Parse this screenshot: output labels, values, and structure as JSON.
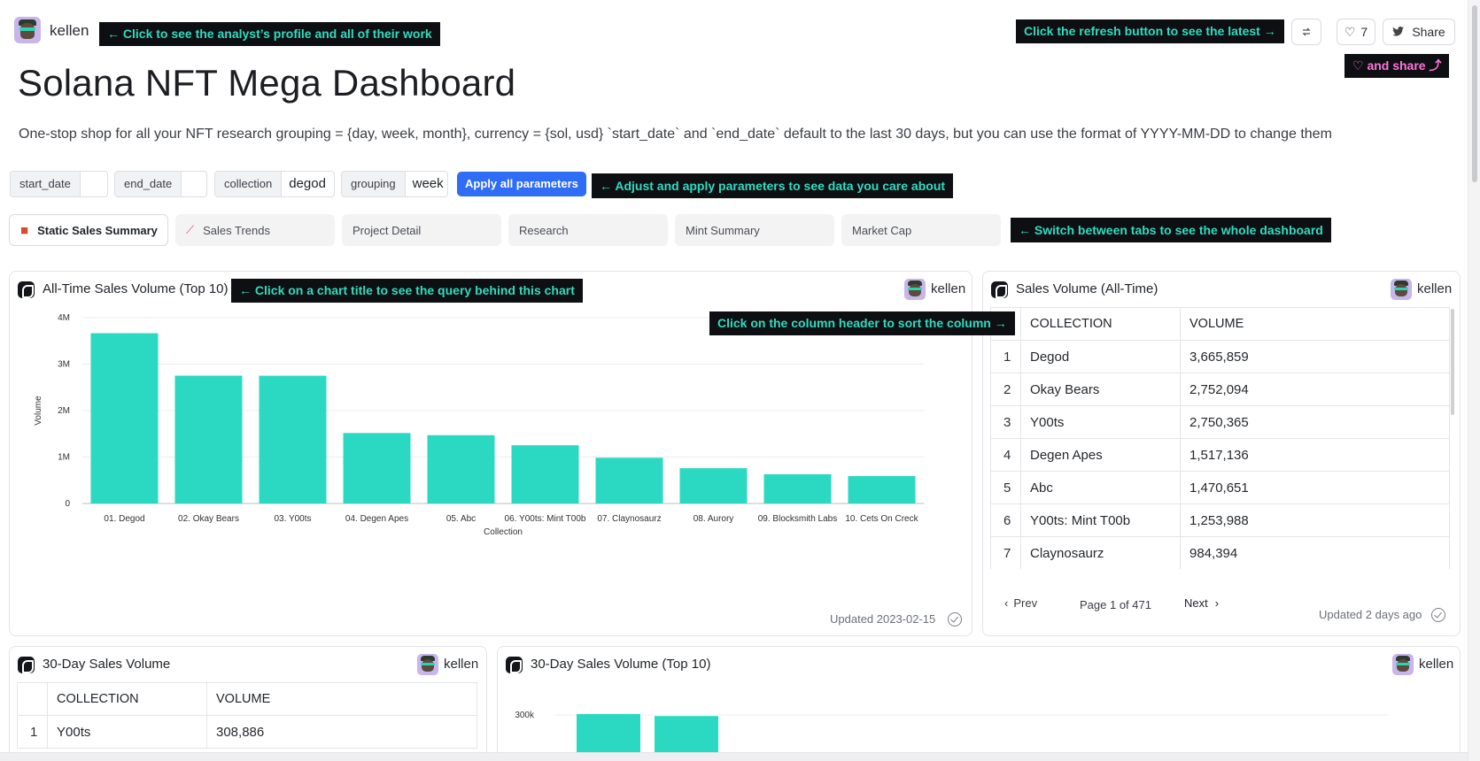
{
  "header": {
    "author": "kellen",
    "title": "Solana NFT Mega Dashboard",
    "description": "One-stop shop for all your NFT research grouping = {day, week, month}, currency = {sol, usd} `start_date` and `end_date` default to the last 30 days, but you can use the format of YYYY-MM-DD to change them",
    "likes": "7",
    "share_label": "Share"
  },
  "tips": {
    "profile": "← Click to see the analyst’s profile and all of their work",
    "refresh": "Click the refresh button to see the latest →",
    "heart_share": "♡ and share ⤴",
    "params": "← Adjust and apply parameters to see data you care about",
    "tabs": "← Switch between tabs to see the whole dashboard",
    "chart_title": "← Click on a chart title to see the query behind this chart",
    "column_sort": "Click on the column header to sort the column →"
  },
  "params": [
    {
      "label": "start_date",
      "value": ""
    },
    {
      "label": "end_date",
      "value": ""
    },
    {
      "label": "collection",
      "value": "degod"
    },
    {
      "label": "grouping",
      "value": "week"
    }
  ],
  "apply_label": "Apply all parameters",
  "tabs": [
    {
      "label": "Static Sales Summary",
      "icon": "gift-icon"
    },
    {
      "label": "Sales Trends",
      "icon": "chart-increasing-icon"
    },
    {
      "label": "Project Detail"
    },
    {
      "label": "Research"
    },
    {
      "label": "Mint Summary"
    },
    {
      "label": "Market Cap"
    }
  ],
  "panels": {
    "all_time_chart": {
      "title": "All-Time Sales Volume (Top 10)",
      "author": "kellen",
      "updated": "Updated 2023-02-15"
    },
    "all_time_table": {
      "title": "Sales Volume (All-Time)",
      "author": "kellen",
      "columns": [
        "COLLECTION",
        "VOLUME"
      ],
      "rows": [
        [
          "1",
          "Degod",
          "3,665,859"
        ],
        [
          "2",
          "Okay Bears",
          "2,752,094"
        ],
        [
          "3",
          "Y00ts",
          "2,750,365"
        ],
        [
          "4",
          "Degen Apes",
          "1,517,136"
        ],
        [
          "5",
          "Abc",
          "1,470,651"
        ],
        [
          "6",
          "Y00ts: Mint T00b",
          "1,253,988"
        ],
        [
          "7",
          "Claynosaurz",
          "984,394"
        ]
      ],
      "prev_label": "Prev",
      "page_label": "Page 1 of 471",
      "next_label": "Next",
      "updated": "Updated 2 days ago"
    },
    "thirty_day_table": {
      "title": "30-Day Sales Volume",
      "author": "kellen",
      "columns": [
        "COLLECTION",
        "VOLUME"
      ],
      "rows": [
        [
          "1",
          "Y00ts",
          "308,886"
        ]
      ]
    },
    "thirty_day_chart": {
      "title": "30-Day Sales Volume (Top 10)",
      "author": "kellen",
      "tick_top": "300k"
    }
  },
  "chart_data": [
    {
      "type": "bar",
      "title": "All-Time Sales Volume (Top 10)",
      "xlabel": "Collection",
      "ylabel": "Volume",
      "categories": [
        "01. Degod",
        "02. Okay Bears",
        "03. Y00ts",
        "04. Degen Apes",
        "05. Abc",
        "06. Y00ts: Mint T00b",
        "07. Claynosaurz",
        "08. Aurory",
        "09. Blocksmith Labs",
        "10. Cets On Creck"
      ],
      "values": [
        3665859,
        2752094,
        2750365,
        1517136,
        1470651,
        1253988,
        984394,
        760000,
        630000,
        590000
      ],
      "ylim": [
        0,
        4000000
      ],
      "yticks": [
        0,
        1000000,
        2000000,
        3000000,
        4000000
      ],
      "ytick_labels": [
        "0",
        "1M",
        "2M",
        "3M",
        "4M"
      ],
      "color": "#2bd9c2",
      "grid": true
    },
    {
      "type": "bar",
      "title": "30-Day Sales Volume (Top 10)",
      "values": [
        308886,
        290000
      ],
      "yticks": [
        300000
      ],
      "ytick_labels": [
        "300k"
      ],
      "color": "#2bd9c2"
    }
  ]
}
